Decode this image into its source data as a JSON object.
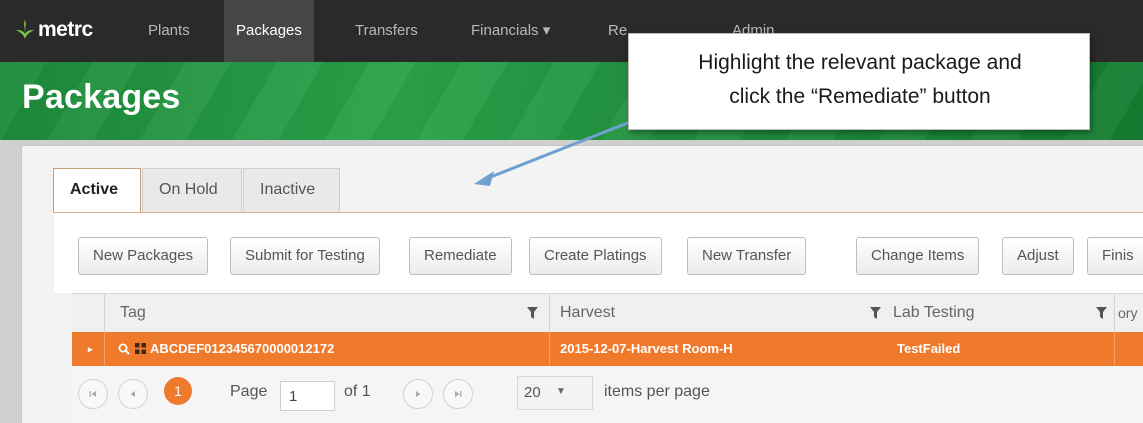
{
  "app": {
    "logo_text": "metrc",
    "logo_icon": "leaf-icon",
    "brand_color": "#1f9442",
    "accent_color": "#f07a2c"
  },
  "nav": {
    "items": [
      {
        "label": "Plants"
      },
      {
        "label": "Packages"
      },
      {
        "label": "Transfers"
      },
      {
        "label": "Financials ▾"
      },
      {
        "label": "Re"
      },
      {
        "label": "Admin"
      }
    ]
  },
  "page": {
    "title": "Packages"
  },
  "tabs": [
    {
      "label": "Active",
      "selected": true
    },
    {
      "label": "On Hold",
      "selected": false
    },
    {
      "label": "Inactive",
      "selected": false
    }
  ],
  "toolbar": {
    "buttons": [
      {
        "label": "New Packages"
      },
      {
        "label": "Submit for Testing"
      },
      {
        "label": "Remediate"
      },
      {
        "label": "Create Platings"
      },
      {
        "label": "New Transfer"
      },
      {
        "label": "Change Items"
      },
      {
        "label": "Adjust"
      },
      {
        "label": "Finis"
      }
    ]
  },
  "grid": {
    "columns": [
      {
        "label": "Tag"
      },
      {
        "label": "Harvest"
      },
      {
        "label": "Lab Testing"
      },
      {
        "label": "ory"
      }
    ],
    "rows": [
      {
        "tag": "ABCDEF012345670000012172",
        "harvest": "2015-12-07-Harvest Room-H",
        "lab_testing": "TestFailed"
      }
    ]
  },
  "pager": {
    "current_page": "1",
    "page_label": "Page",
    "page_value": "1",
    "of_label": "of 1",
    "per_page_value": "20",
    "per_page_label": "items per page"
  },
  "callout": {
    "line1": "Highlight the relevant package and",
    "line2": "click the “Remediate” button"
  }
}
